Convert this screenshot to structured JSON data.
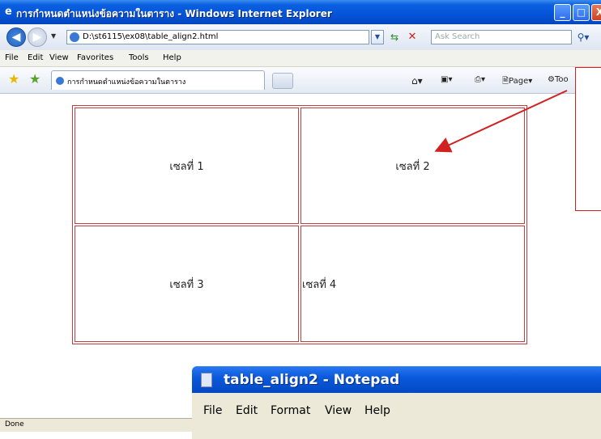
{
  "window": {
    "title": "การกำหนดตำแหน่งข้อความในตาราง - Windows Internet Explorer",
    "controls": {
      "minimize": "_",
      "maximize": "□",
      "close": "X"
    }
  },
  "address_bar": {
    "url": "D:\\st6115\\ex08\\table_align2.html",
    "search_placeholder": "Ask Search"
  },
  "menu": [
    "File",
    "Edit",
    "View",
    "Favorites",
    "Tools",
    "Help"
  ],
  "tab": {
    "title": "การกำหนดตำแหน่งข้อความในตาราง"
  },
  "toolbar": {
    "page": "Page",
    "tools": "Too"
  },
  "table": {
    "cells": [
      {
        "text": "เซลที่ 1",
        "align": "center"
      },
      {
        "text": "เซลที่ 2",
        "align": "center"
      },
      {
        "text": "เซลที่ 3",
        "align": "center"
      },
      {
        "text": "เซลที่ 4",
        "align": "left"
      }
    ]
  },
  "status": {
    "text": "Done"
  },
  "notepad": {
    "title": "table_align2 - Notepad",
    "menu": [
      "File",
      "Edit",
      "Format",
      "View",
      "Help"
    ]
  },
  "colors": {
    "xp_blue": "#0454d8",
    "table_border": "#c04040",
    "callout": "#d02020"
  }
}
